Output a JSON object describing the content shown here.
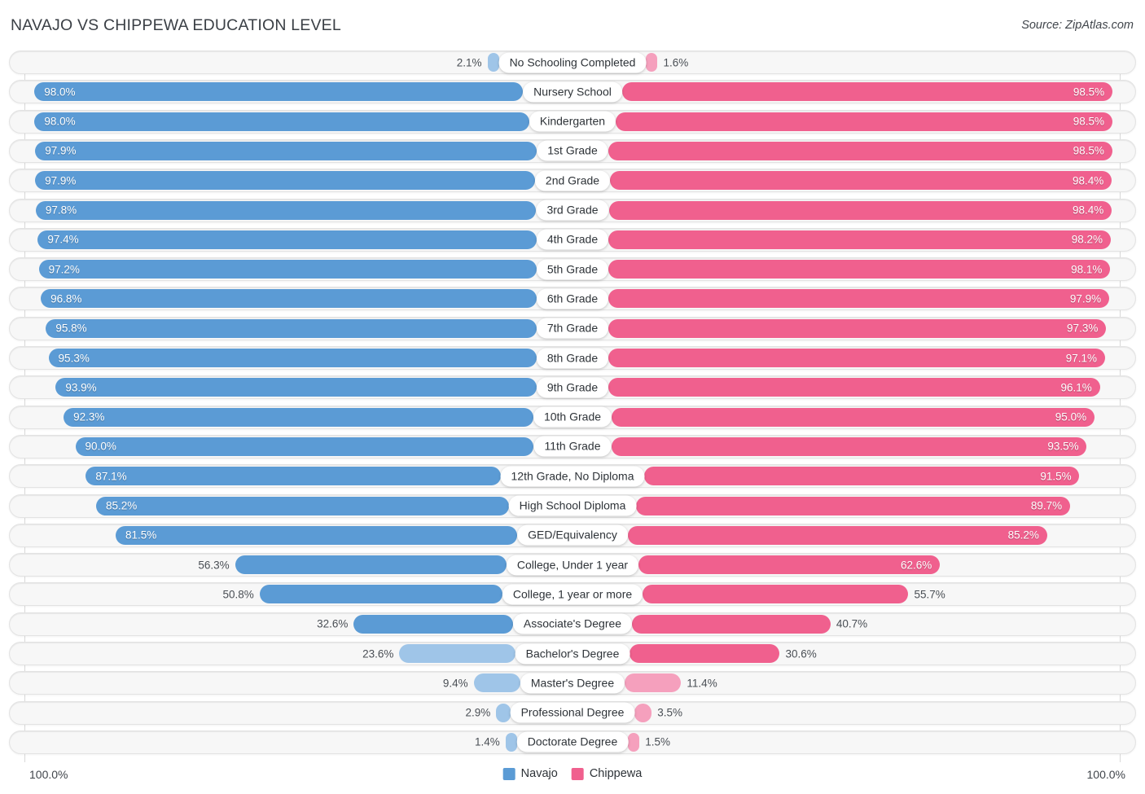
{
  "header": {
    "title": "NAVAJO VS CHIPPEWA EDUCATION LEVEL",
    "source": "Source: ZipAtlas.com"
  },
  "footer": {
    "axis_min": "100.0%",
    "axis_max": "100.0%"
  },
  "legend": {
    "items": [
      {
        "label": "Navajo",
        "color": "#5b9bd5"
      },
      {
        "label": "Chippewa",
        "color": "#f0608e"
      }
    ]
  },
  "colors": {
    "navajo_strong": "#5b9bd5",
    "navajo_light": "#9fc5e8",
    "chippewa_strong": "#f0608e",
    "chippewa_light": "#f5a0bd",
    "track": "#f7f7f7",
    "track_border": "#e3e3e3",
    "gridline": "#d9d9d9"
  },
  "chart_data": {
    "type": "bar",
    "title": "NAVAJO VS CHIPPEWA EDUCATION LEVEL",
    "subtitle": "",
    "orientation": "horizontal-diverging",
    "xlabel": "",
    "ylabel": "",
    "xlim": [
      0,
      100
    ],
    "grid": true,
    "legend_position": "bottom-center",
    "axis_min_label": "100.0%",
    "axis_max_label": "100.0%",
    "categories": [
      "No Schooling Completed",
      "Nursery School",
      "Kindergarten",
      "1st Grade",
      "2nd Grade",
      "3rd Grade",
      "4th Grade",
      "5th Grade",
      "6th Grade",
      "7th Grade",
      "8th Grade",
      "9th Grade",
      "10th Grade",
      "11th Grade",
      "12th Grade, No Diploma",
      "High School Diploma",
      "GED/Equivalency",
      "College, Under 1 year",
      "College, 1 year or more",
      "Associate's Degree",
      "Bachelor's Degree",
      "Master's Degree",
      "Professional Degree",
      "Doctorate Degree"
    ],
    "series": [
      {
        "name": "Navajo",
        "side": "left",
        "color": "#5b9bd5",
        "values": [
          2.1,
          98.0,
          98.0,
          97.9,
          97.9,
          97.8,
          97.4,
          97.2,
          96.8,
          95.8,
          95.3,
          93.9,
          92.3,
          90.0,
          87.1,
          85.2,
          81.5,
          56.3,
          50.8,
          32.6,
          23.6,
          9.4,
          2.9,
          1.4
        ],
        "labels": [
          "2.1%",
          "98.0%",
          "98.0%",
          "97.9%",
          "97.9%",
          "97.8%",
          "97.4%",
          "97.2%",
          "96.8%",
          "95.8%",
          "95.3%",
          "93.9%",
          "92.3%",
          "90.0%",
          "87.1%",
          "85.2%",
          "81.5%",
          "56.3%",
          "50.8%",
          "32.6%",
          "23.6%",
          "9.4%",
          "2.9%",
          "1.4%"
        ]
      },
      {
        "name": "Chippewa",
        "side": "right",
        "color": "#f0608e",
        "values": [
          1.6,
          98.5,
          98.5,
          98.5,
          98.4,
          98.4,
          98.2,
          98.1,
          97.9,
          97.3,
          97.1,
          96.1,
          95.0,
          93.5,
          91.5,
          89.7,
          85.2,
          62.6,
          55.7,
          40.7,
          30.6,
          11.4,
          3.5,
          1.5
        ],
        "labels": [
          "1.6%",
          "98.5%",
          "98.5%",
          "98.5%",
          "98.4%",
          "98.4%",
          "98.2%",
          "98.1%",
          "97.9%",
          "97.3%",
          "97.1%",
          "96.1%",
          "95.0%",
          "93.5%",
          "91.5%",
          "89.7%",
          "85.2%",
          "62.6%",
          "55.7%",
          "40.7%",
          "30.6%",
          "11.4%",
          "3.5%",
          "1.5%"
        ]
      }
    ]
  }
}
